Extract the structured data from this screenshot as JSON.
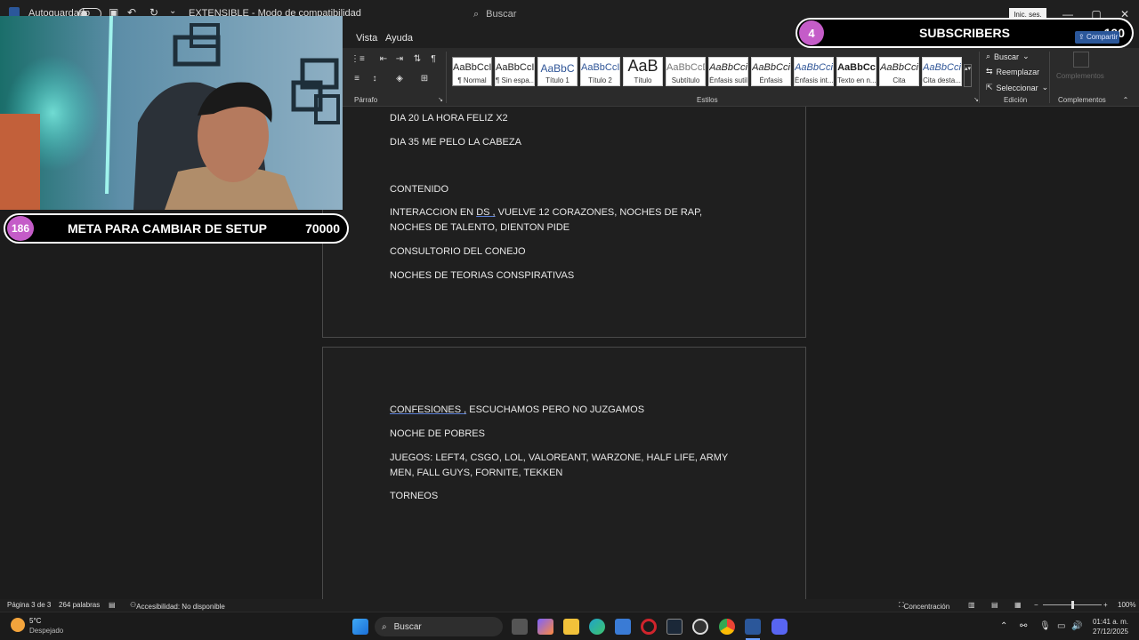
{
  "titlebar": {
    "autosave_label": "Autoguardado",
    "doc_title": "EXTENSIBLE - Modo de compatibilidad",
    "search_placeholder": "Buscar",
    "signin_label": "Inic. ses."
  },
  "menu": {
    "items": [
      "Vista",
      "Ayuda"
    ]
  },
  "ribbon": {
    "paragraph_label": "Párrafo",
    "styles_label": "Estilos",
    "edit_label": "Edición",
    "addins_label": "Complementos",
    "addins_btn": "Complementos",
    "buscar": "Buscar",
    "reemplazar": "Reemplazar",
    "seleccionar": "Seleccionar",
    "share_label": "Compartir",
    "styles": [
      {
        "sample": "AaBbCcI",
        "name": "¶ Normal"
      },
      {
        "sample": "AaBbCcI",
        "name": "¶ Sin espa..."
      },
      {
        "sample": "AaBbC",
        "name": "Título 1"
      },
      {
        "sample": "AaBbCcI",
        "name": "Título 2"
      },
      {
        "sample": "AaB",
        "name": "Título"
      },
      {
        "sample": "AaBbCcD",
        "name": "Subtítulo"
      },
      {
        "sample": "AaBbCci",
        "name": "Énfasis sutil"
      },
      {
        "sample": "AaBbCci",
        "name": "Énfasis"
      },
      {
        "sample": "AaBbCci",
        "name": "Énfasis int..."
      },
      {
        "sample": "AaBbCc",
        "name": "Texto en n..."
      },
      {
        "sample": "AaBbCci",
        "name": "Cita"
      },
      {
        "sample": "AaBbCci",
        "name": "Cita desta..."
      }
    ]
  },
  "document": {
    "page1": [
      "DIA 20 LA HORA FELIZ X2",
      "DIA 35 ME PELO LA CABEZA",
      "CONTENIDO",
      "INTERACCION EN DS , VUELVE 12 CORAZONES, NOCHES DE RAP, NOCHES DE TALENTO, DIENTON PIDE",
      "CONSULTORIO DEL CONEJO",
      "NOCHES DE TEORIAS CONSPIRATIVAS"
    ],
    "page2": [
      "CONFESIONES , ESCUCHAMOS PERO NO JUZGAMOS",
      "NOCHE DE POBRES",
      "JUEGOS: LEFT4, CSGO, LOL, VALOREANT, WARZONE, HALF LIFE, ARMY MEN, FALL GUYS, FORNITE, TEKKEN",
      "TORNEOS"
    ]
  },
  "overlay": {
    "subs_count": "4",
    "subs_label": "SUBSCRIBERS",
    "subs_goal": "100",
    "meta_count": "186",
    "meta_label": "META PARA CAMBIAR DE SETUP",
    "meta_goal": "70000"
  },
  "statusbar": {
    "page": "Página 3 de 3",
    "words": "264 palabras",
    "accessibility": "Accesibilidad: No disponible",
    "focus": "Concentración",
    "zoom": "100%"
  },
  "taskbar": {
    "weather_temp": "5°C",
    "weather_desc": "Despejado",
    "search": "Buscar",
    "time": "01:41 a. m.",
    "date": "27/12/2025"
  },
  "colors": {
    "accent": "#2b579a",
    "bubble": "#c45cc8",
    "webcam_glow": "#38d6c8"
  }
}
